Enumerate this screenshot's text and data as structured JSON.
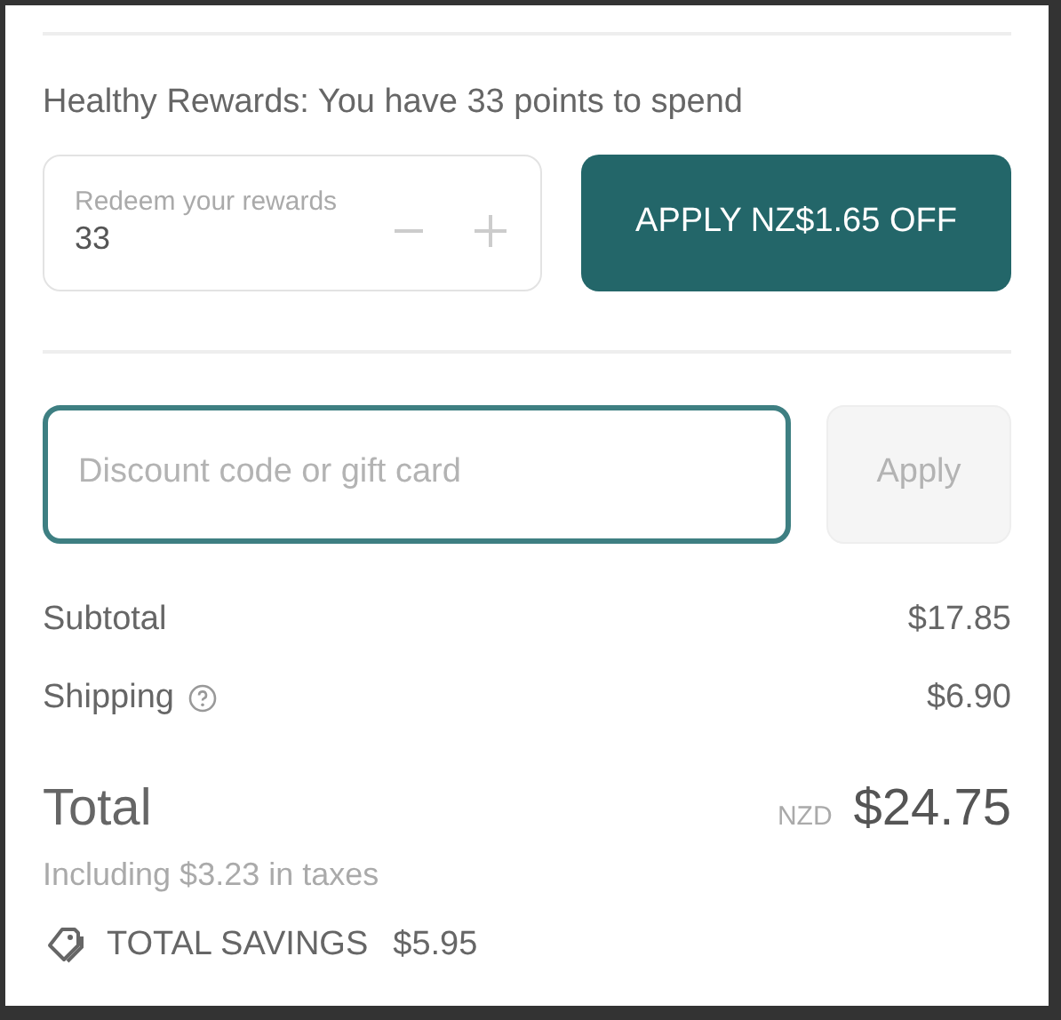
{
  "rewards": {
    "heading": "Healthy Rewards: You have 33 points to spend",
    "field": {
      "label": "Redeem your rewards",
      "value": "33"
    },
    "apply_button": "APPLY NZ$1.65 OFF"
  },
  "discount": {
    "placeholder": "Discount code or gift card",
    "focused": true,
    "apply_button": "Apply",
    "apply_disabled": true
  },
  "summary": [
    {
      "label": "Subtotal",
      "value": "$17.85",
      "info": false
    },
    {
      "label": "Shipping",
      "value": "$6.90",
      "info": true
    }
  ],
  "total": {
    "label": "Total",
    "currency": "NZD",
    "value": "$24.75",
    "taxes": "Including $3.23 in taxes"
  },
  "savings": {
    "label": "TOTAL SAVINGS",
    "value": "$5.95"
  }
}
